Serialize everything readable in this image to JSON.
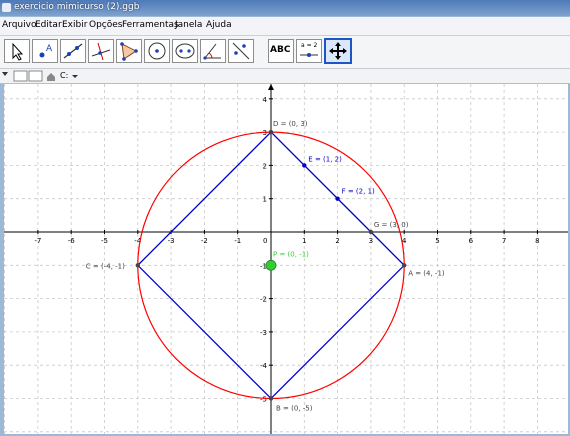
{
  "window": {
    "title": "exercicio mimicurso (2).ggb"
  },
  "menu": [
    "Arquivo",
    "Editar",
    "Exibir",
    "Opções",
    "Ferramentas",
    "Janela",
    "Ajuda"
  ],
  "toolbar": {
    "tools": [
      "move",
      "point",
      "line",
      "perpendicular",
      "polygon",
      "circle",
      "conic",
      "angle",
      "reflect",
      "text",
      "slider",
      "move-graphics"
    ],
    "text_tool_label": "ABC",
    "slider_label": "a = 2",
    "selected": "move-graphics"
  },
  "stylebar": {
    "drive_label": "C:"
  },
  "graphics": {
    "x_ticks": [
      "-7",
      "-6",
      "-5",
      "-4",
      "-3",
      "-2",
      "-1",
      "0",
      "1",
      "2",
      "3",
      "4",
      "5",
      "6",
      "7",
      "8"
    ],
    "y_ticks": [
      "4",
      "3",
      "2",
      "1",
      "-1",
      "-2",
      "-3",
      "-4",
      "-5"
    ],
    "points": {
      "D": "D = (0, 3)",
      "E": "E = (1, 2)",
      "F": "F = (2, 1)",
      "G": "G = (3, 0)",
      "C": "C = (-4, -1)",
      "P": "P = (0, -1)",
      "A": "A = (4, -1)",
      "B": "B = (0, -5)"
    },
    "colors": {
      "circle": "#ff0000",
      "polygon": "#0000cc",
      "point_p": "#33cc33",
      "labels_blue": "#0000cc"
    }
  }
}
